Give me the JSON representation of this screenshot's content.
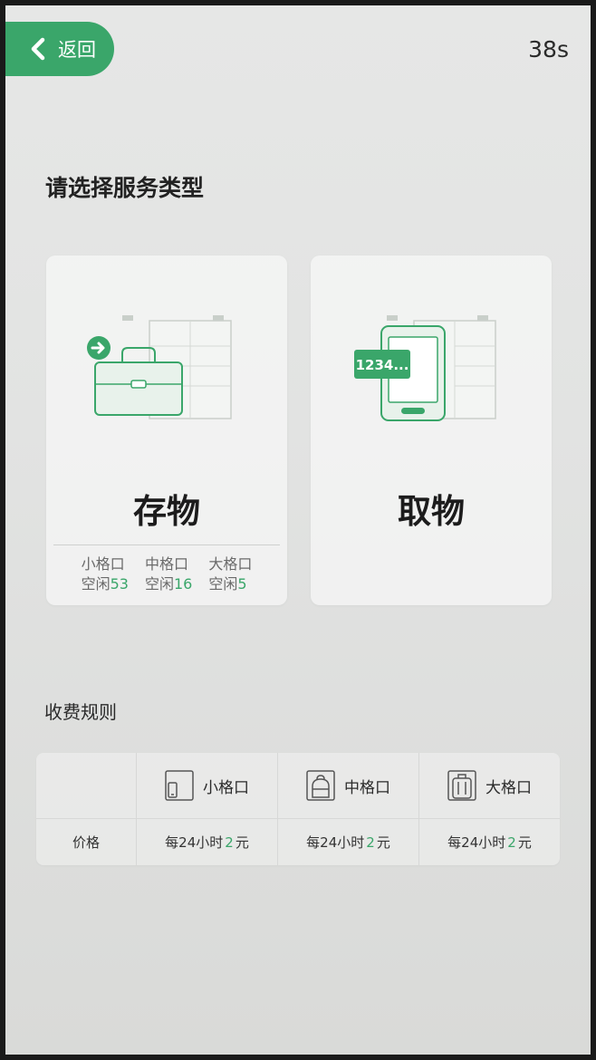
{
  "header": {
    "back_label": "返回",
    "timer": "38s"
  },
  "main": {
    "section_title": "请选择服务类型",
    "store_card": {
      "label": "存物",
      "availability": [
        {
          "size": "小格口",
          "status": "空闲",
          "count": "53"
        },
        {
          "size": "中格口",
          "status": "空闲",
          "count": "16"
        },
        {
          "size": "大格口",
          "status": "空闲",
          "count": "5"
        }
      ]
    },
    "take_card": {
      "label": "取物",
      "code_sample": "1234..."
    }
  },
  "fees": {
    "title": "收费规则",
    "row_label": "价格",
    "columns": [
      {
        "name": "小格口",
        "icon": "phone-icon",
        "price_prefix": "每24小时",
        "price": "2",
        "unit": "元"
      },
      {
        "name": "中格口",
        "icon": "backpack-icon",
        "price_prefix": "每24小时",
        "price": "2",
        "unit": "元"
      },
      {
        "name": "大格口",
        "icon": "suitcase-icon",
        "price_prefix": "每24小时",
        "price": "2",
        "unit": "元"
      }
    ]
  },
  "colors": {
    "accent": "#3aa66a",
    "text": "#222222"
  }
}
